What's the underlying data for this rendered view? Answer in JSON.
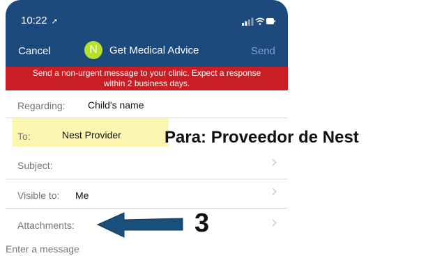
{
  "status": {
    "time": "10:22",
    "location_glyph": "➚"
  },
  "nav": {
    "cancel": "Cancel",
    "avatar_letter": "N",
    "title": "Get Medical Advice",
    "send": "Send"
  },
  "banner": {
    "line1": "Send a non-urgent message to your clinic. Expect a response",
    "line2": "within 2 business days."
  },
  "form": {
    "regarding_label": "Regarding:",
    "regarding_value": "Child's name",
    "to_label": "To:",
    "to_value": "Nest Provider",
    "subject_label": "Subject:",
    "visible_label": "Visible to:",
    "visible_value": "Me",
    "attachments_label": "Attachments:",
    "message_placeholder": "Enter a message"
  },
  "annotations": {
    "to_translation": "Para: Proveedor de Nest",
    "step_number": "3"
  },
  "colors": {
    "header": "#1d4a7d",
    "banner": "#cb1e24",
    "avatar": "#b8e02a",
    "highlight": "#fbf7b0",
    "arrow": "#1a4f7a"
  }
}
